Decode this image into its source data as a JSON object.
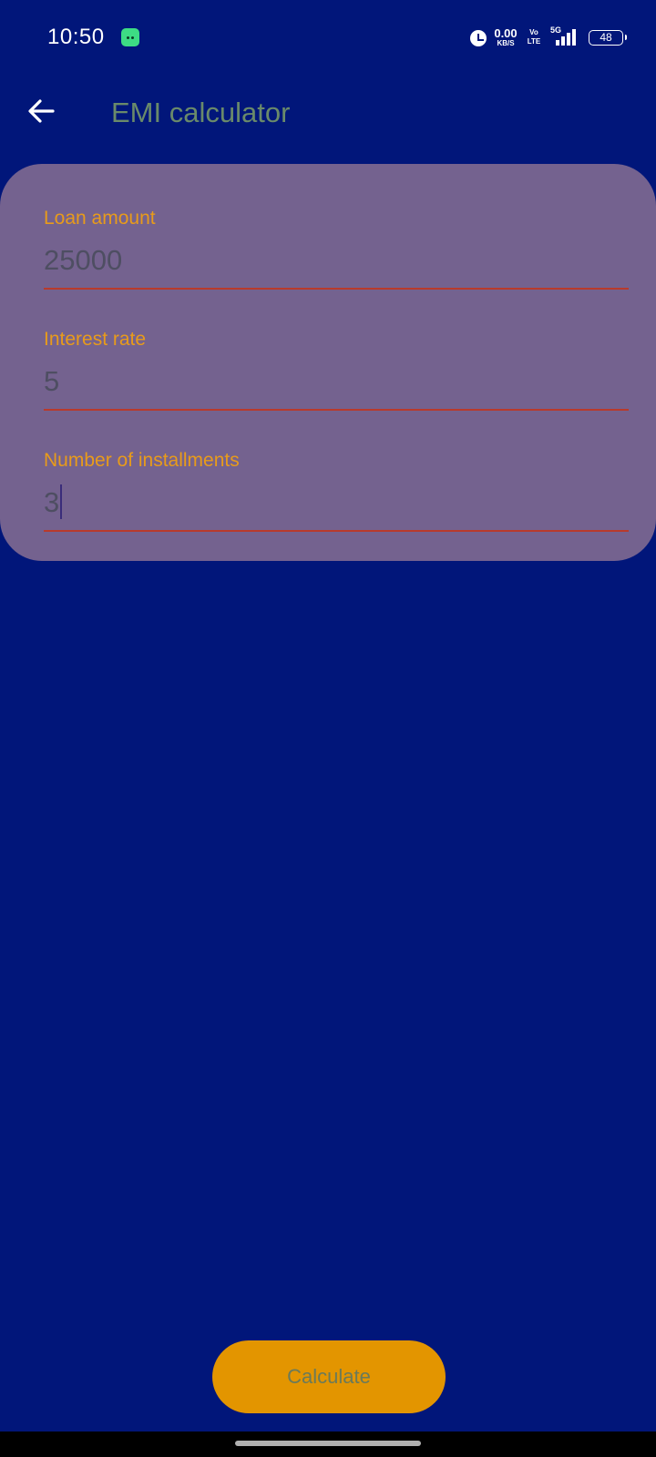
{
  "status_bar": {
    "time": "10:50",
    "net_speed_value": "0.00",
    "net_speed_unit": "KB/S",
    "volte_top": "Vo",
    "volte_bottom": "LTE",
    "network_type": "5G",
    "battery_level": "48",
    "icons": [
      "android-app-icon",
      "alarm-icon",
      "signal-icon",
      "battery-icon"
    ]
  },
  "toolbar": {
    "back_icon": "arrow-left-icon",
    "title": "EMI calculator"
  },
  "form": {
    "fields": [
      {
        "label": "Loan amount",
        "value": "25000"
      },
      {
        "label": "Interest rate",
        "value": "5"
      },
      {
        "label": "Number of installments",
        "value": "3"
      }
    ]
  },
  "actions": {
    "calculate_label": "Calculate"
  },
  "colors": {
    "background": "#01167a",
    "card": "#74628f",
    "label": "#e89b1b",
    "underline": "#b83a2c",
    "button": "#e39500"
  }
}
